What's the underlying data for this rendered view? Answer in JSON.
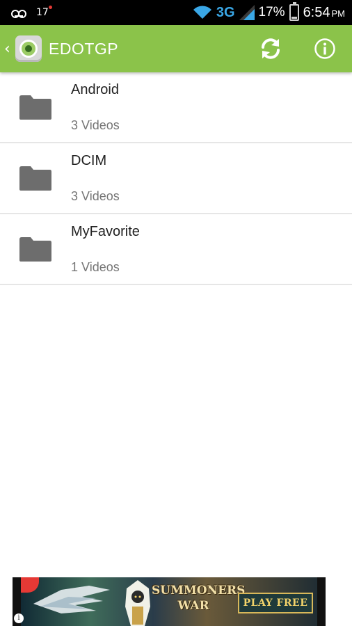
{
  "status_bar": {
    "voicemail_icon": "voicemail-icon",
    "notification_text": "17",
    "network_type": "3G",
    "battery_percent": "17%",
    "battery_level": 0.17,
    "time": "6:54",
    "time_suffix": "PM",
    "network_color": "#3aa7e6"
  },
  "action_bar": {
    "title": "EDOTGP",
    "up_glyph": "‹",
    "background_color": "#8bc34a",
    "refresh_icon": "refresh-icon",
    "info_icon": "info-icon"
  },
  "folders": [
    {
      "name": "Android",
      "count": "3 Videos"
    },
    {
      "name": "DCIM",
      "count": "3 Videos"
    },
    {
      "name": "MyFavorite",
      "count": "1 Videos"
    }
  ],
  "ad": {
    "game_title_line1": "SUMMONERS",
    "game_title_line2": "WAR",
    "cta_label": "PLAY FREE",
    "info_glyph": "i"
  }
}
